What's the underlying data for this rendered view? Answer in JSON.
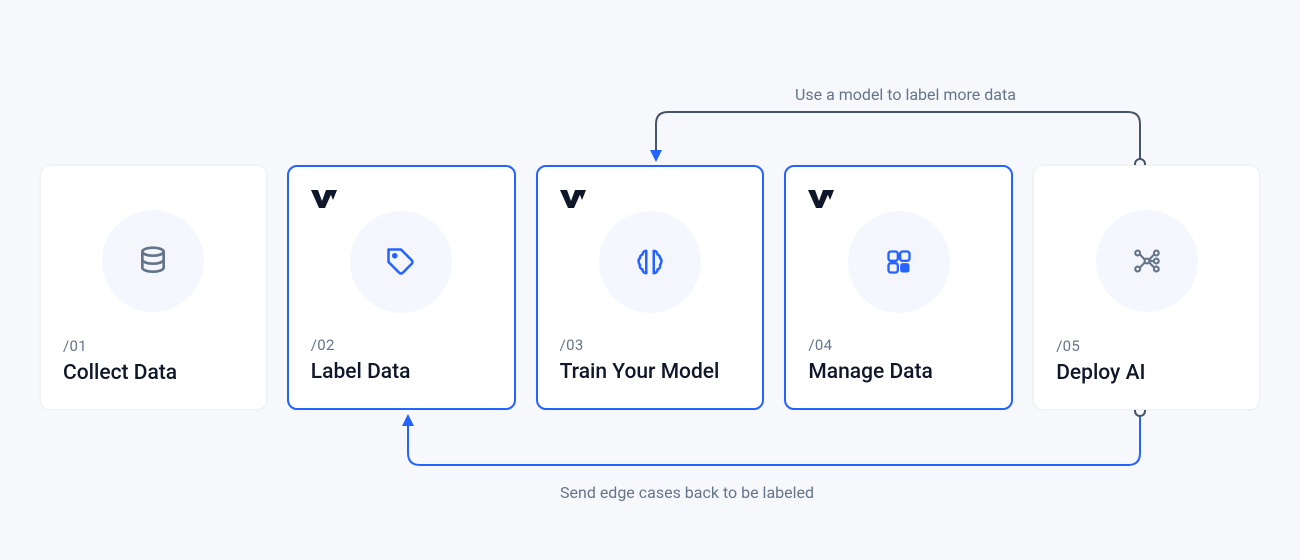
{
  "steps": [
    {
      "num": "/01",
      "title": "Collect Data"
    },
    {
      "num": "/02",
      "title": "Label Data"
    },
    {
      "num": "/03",
      "title": "Train Your Model"
    },
    {
      "num": "/04",
      "title": "Manage Data"
    },
    {
      "num": "/05",
      "title": "Deploy AI"
    }
  ],
  "annotations": {
    "top": "Use a model to label more data",
    "bottom": "Send edge cases back to be labeled"
  },
  "colors": {
    "accent": "#2463ff",
    "arrow_dark": "#475569",
    "text_muted": "#64758b",
    "text": "#0f172a"
  }
}
